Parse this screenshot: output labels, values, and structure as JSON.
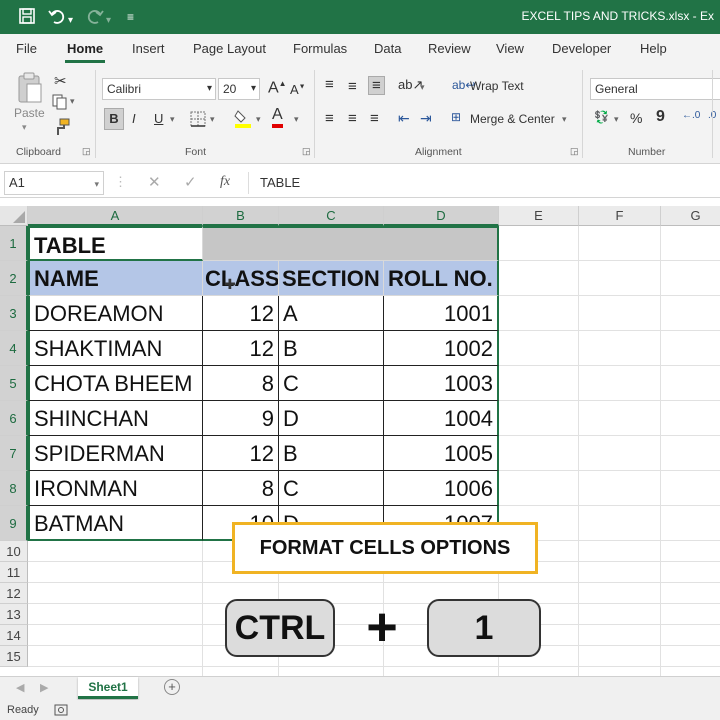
{
  "title_bar": {
    "filename": "EXCEL TIPS AND TRICKS.xlsx - Ex",
    "icons": [
      "save-icon",
      "undo-icon",
      "redo-icon",
      "customize-qat-icon"
    ]
  },
  "ribbon_tabs": [
    "File",
    "Home",
    "Insert",
    "Page Layout",
    "Formulas",
    "Data",
    "Review",
    "View",
    "Developer",
    "Help"
  ],
  "active_tab": "Home",
  "clipboard": {
    "paste_label": "Paste",
    "group_label": "Clipboard"
  },
  "font": {
    "name": "Calibri",
    "size": "20",
    "bold": "B",
    "italic": "I",
    "underline": "U",
    "font_color_glyph": "A",
    "group_label": "Font"
  },
  "alignment": {
    "wrap_text": "Wrap Text",
    "merge_center": "Merge & Center",
    "group_label": "Alignment"
  },
  "number": {
    "format": "General",
    "percent": "%",
    "comma": "9",
    "group_label": "Number"
  },
  "formula_bar": {
    "name_box": "A1",
    "fx": "fx",
    "content": "TABLE"
  },
  "columns": [
    "A",
    "B",
    "C",
    "D",
    "E",
    "F",
    "G"
  ],
  "rows": [
    "1",
    "2",
    "3",
    "4",
    "5",
    "6",
    "7",
    "8",
    "9",
    "10",
    "11",
    "12",
    "13",
    "14",
    "15"
  ],
  "table": {
    "title": "TABLE",
    "headers": [
      "NAME",
      "CLASS",
      "SECTION",
      "ROLL NO."
    ],
    "data": [
      [
        "DOREAMON",
        "12",
        "A",
        "1001"
      ],
      [
        "SHAKTIMAN",
        "12",
        "B",
        "1002"
      ],
      [
        "CHOTA BHEEM",
        "8",
        "C",
        "1003"
      ],
      [
        "SHINCHAN",
        "9",
        "D",
        "1004"
      ],
      [
        "SPIDERMAN",
        "12",
        "B",
        "1005"
      ],
      [
        "IRONMAN",
        "8",
        "C",
        "1006"
      ],
      [
        "BATMAN",
        "10",
        "D",
        "1007"
      ]
    ]
  },
  "overlay": {
    "caption": "FORMAT CELLS OPTIONS",
    "key1": "CTRL",
    "plus": "+",
    "key2": "1"
  },
  "sheet_tabs": [
    "Sheet1"
  ],
  "status": {
    "ready": "Ready"
  },
  "colors": {
    "excel_green": "#217346",
    "header_fill": "#b4c6e7",
    "caption_border": "#f0b323"
  }
}
